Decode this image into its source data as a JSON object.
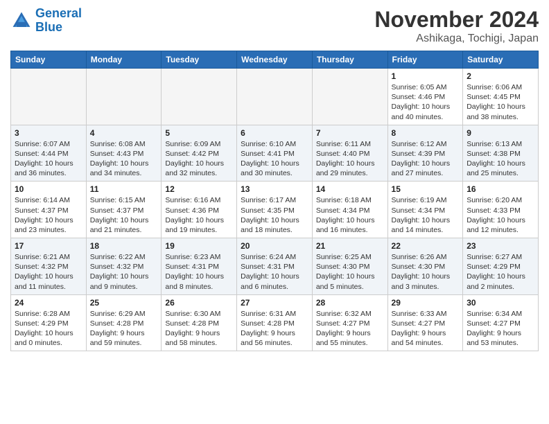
{
  "header": {
    "logo_line1": "General",
    "logo_line2": "Blue",
    "month": "November 2024",
    "location": "Ashikaga, Tochigi, Japan"
  },
  "weekdays": [
    "Sunday",
    "Monday",
    "Tuesday",
    "Wednesday",
    "Thursday",
    "Friday",
    "Saturday"
  ],
  "weeks": [
    [
      {
        "day": "",
        "info": ""
      },
      {
        "day": "",
        "info": ""
      },
      {
        "day": "",
        "info": ""
      },
      {
        "day": "",
        "info": ""
      },
      {
        "day": "",
        "info": ""
      },
      {
        "day": "1",
        "info": "Sunrise: 6:05 AM\nSunset: 4:46 PM\nDaylight: 10 hours\nand 40 minutes."
      },
      {
        "day": "2",
        "info": "Sunrise: 6:06 AM\nSunset: 4:45 PM\nDaylight: 10 hours\nand 38 minutes."
      }
    ],
    [
      {
        "day": "3",
        "info": "Sunrise: 6:07 AM\nSunset: 4:44 PM\nDaylight: 10 hours\nand 36 minutes."
      },
      {
        "day": "4",
        "info": "Sunrise: 6:08 AM\nSunset: 4:43 PM\nDaylight: 10 hours\nand 34 minutes."
      },
      {
        "day": "5",
        "info": "Sunrise: 6:09 AM\nSunset: 4:42 PM\nDaylight: 10 hours\nand 32 minutes."
      },
      {
        "day": "6",
        "info": "Sunrise: 6:10 AM\nSunset: 4:41 PM\nDaylight: 10 hours\nand 30 minutes."
      },
      {
        "day": "7",
        "info": "Sunrise: 6:11 AM\nSunset: 4:40 PM\nDaylight: 10 hours\nand 29 minutes."
      },
      {
        "day": "8",
        "info": "Sunrise: 6:12 AM\nSunset: 4:39 PM\nDaylight: 10 hours\nand 27 minutes."
      },
      {
        "day": "9",
        "info": "Sunrise: 6:13 AM\nSunset: 4:38 PM\nDaylight: 10 hours\nand 25 minutes."
      }
    ],
    [
      {
        "day": "10",
        "info": "Sunrise: 6:14 AM\nSunset: 4:37 PM\nDaylight: 10 hours\nand 23 minutes."
      },
      {
        "day": "11",
        "info": "Sunrise: 6:15 AM\nSunset: 4:37 PM\nDaylight: 10 hours\nand 21 minutes."
      },
      {
        "day": "12",
        "info": "Sunrise: 6:16 AM\nSunset: 4:36 PM\nDaylight: 10 hours\nand 19 minutes."
      },
      {
        "day": "13",
        "info": "Sunrise: 6:17 AM\nSunset: 4:35 PM\nDaylight: 10 hours\nand 18 minutes."
      },
      {
        "day": "14",
        "info": "Sunrise: 6:18 AM\nSunset: 4:34 PM\nDaylight: 10 hours\nand 16 minutes."
      },
      {
        "day": "15",
        "info": "Sunrise: 6:19 AM\nSunset: 4:34 PM\nDaylight: 10 hours\nand 14 minutes."
      },
      {
        "day": "16",
        "info": "Sunrise: 6:20 AM\nSunset: 4:33 PM\nDaylight: 10 hours\nand 12 minutes."
      }
    ],
    [
      {
        "day": "17",
        "info": "Sunrise: 6:21 AM\nSunset: 4:32 PM\nDaylight: 10 hours\nand 11 minutes."
      },
      {
        "day": "18",
        "info": "Sunrise: 6:22 AM\nSunset: 4:32 PM\nDaylight: 10 hours\nand 9 minutes."
      },
      {
        "day": "19",
        "info": "Sunrise: 6:23 AM\nSunset: 4:31 PM\nDaylight: 10 hours\nand 8 minutes."
      },
      {
        "day": "20",
        "info": "Sunrise: 6:24 AM\nSunset: 4:31 PM\nDaylight: 10 hours\nand 6 minutes."
      },
      {
        "day": "21",
        "info": "Sunrise: 6:25 AM\nSunset: 4:30 PM\nDaylight: 10 hours\nand 5 minutes."
      },
      {
        "day": "22",
        "info": "Sunrise: 6:26 AM\nSunset: 4:30 PM\nDaylight: 10 hours\nand 3 minutes."
      },
      {
        "day": "23",
        "info": "Sunrise: 6:27 AM\nSunset: 4:29 PM\nDaylight: 10 hours\nand 2 minutes."
      }
    ],
    [
      {
        "day": "24",
        "info": "Sunrise: 6:28 AM\nSunset: 4:29 PM\nDaylight: 10 hours\nand 0 minutes."
      },
      {
        "day": "25",
        "info": "Sunrise: 6:29 AM\nSunset: 4:28 PM\nDaylight: 9 hours\nand 59 minutes."
      },
      {
        "day": "26",
        "info": "Sunrise: 6:30 AM\nSunset: 4:28 PM\nDaylight: 9 hours\nand 58 minutes."
      },
      {
        "day": "27",
        "info": "Sunrise: 6:31 AM\nSunset: 4:28 PM\nDaylight: 9 hours\nand 56 minutes."
      },
      {
        "day": "28",
        "info": "Sunrise: 6:32 AM\nSunset: 4:27 PM\nDaylight: 9 hours\nand 55 minutes."
      },
      {
        "day": "29",
        "info": "Sunrise: 6:33 AM\nSunset: 4:27 PM\nDaylight: 9 hours\nand 54 minutes."
      },
      {
        "day": "30",
        "info": "Sunrise: 6:34 AM\nSunset: 4:27 PM\nDaylight: 9 hours\nand 53 minutes."
      }
    ]
  ]
}
